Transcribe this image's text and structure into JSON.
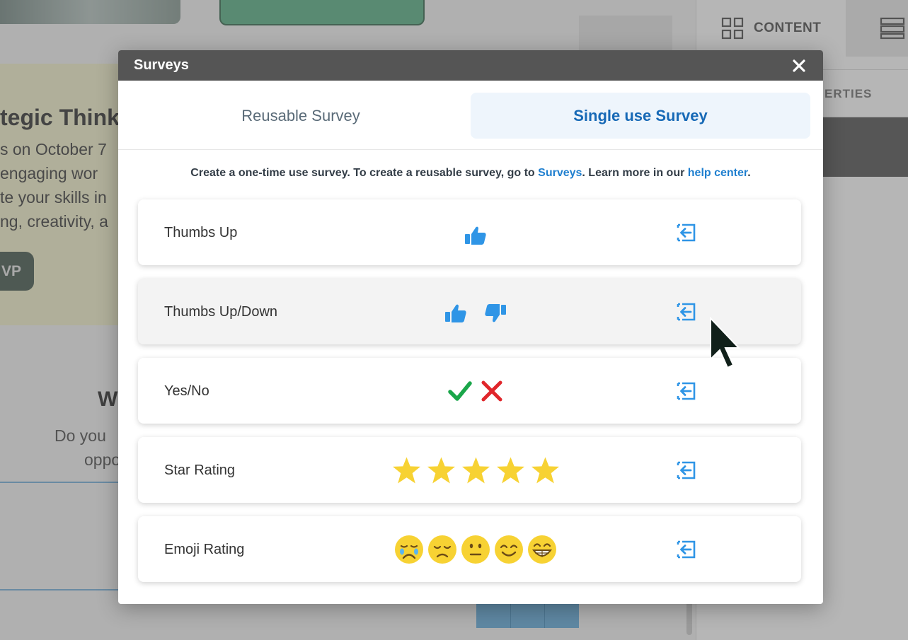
{
  "background": {
    "event_title": "tegic Think",
    "event_lines": [
      "s on October 7",
      " engaging wor",
      "te your skills in",
      "ng, creativity, a"
    ],
    "rsvp_label": "VP",
    "section_title": "W",
    "section_lines": [
      "Do you",
      "oppo"
    ],
    "sidebar_tab_content": "CONTENT",
    "sidebar_tab_properties": "ERTIES"
  },
  "modal": {
    "title": "Surveys",
    "tabs": [
      {
        "label": "Reusable Survey",
        "active": false
      },
      {
        "label": "Single use Survey",
        "active": true
      }
    ],
    "intro": {
      "before": "Create a one-time use survey. To create a reusable survey, go to ",
      "surveys_link": "Surveys",
      "middle": ". Learn more in our ",
      "help_link": "help center",
      "after": "."
    },
    "surveys": [
      {
        "label": "Thumbs Up",
        "icons": [
          "thumbs-up-icon"
        ]
      },
      {
        "label": "Thumbs Up/Down",
        "icons": [
          "thumbs-up-icon",
          "thumbs-down-icon"
        ]
      },
      {
        "label": "Yes/No",
        "icons": [
          "check-icon",
          "x-icon"
        ]
      },
      {
        "label": "Star Rating",
        "icons": [
          "star-icon",
          "star-icon",
          "star-icon",
          "star-icon",
          "star-icon"
        ]
      },
      {
        "label": "Emoji Rating",
        "icons": [
          "crying-emoji-icon",
          "sad-emoji-icon",
          "neutral-emoji-icon",
          "smile-emoji-icon",
          "grin-emoji-icon"
        ]
      }
    ]
  },
  "colors": {
    "accent": "#1769b6",
    "icon_blue": "#2f95e6",
    "check_green": "#1aa64a",
    "x_red": "#e0262b",
    "star_yellow": "#f7d233",
    "header_bg": "#555555"
  }
}
